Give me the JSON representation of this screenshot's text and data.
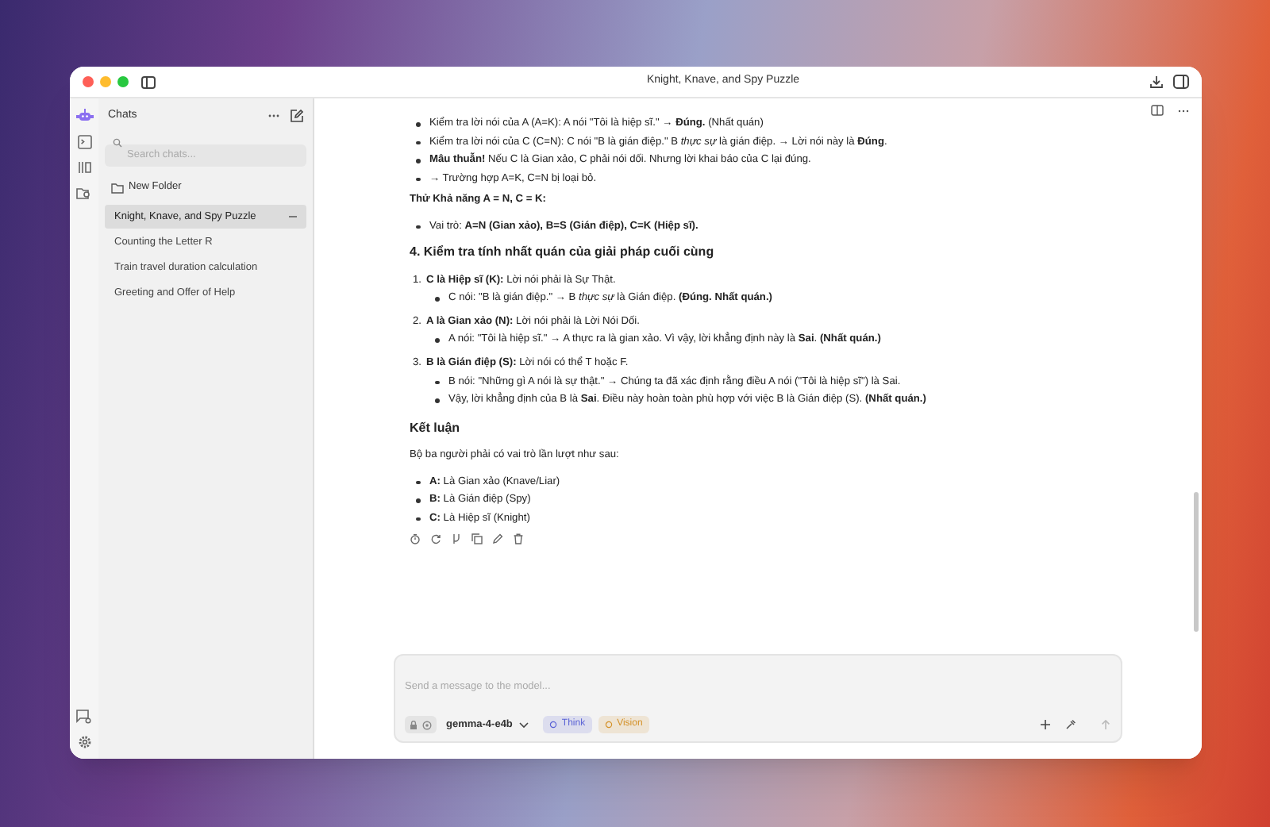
{
  "window": {
    "title": "Knight, Knave, and Spy Puzzle"
  },
  "sidebar": {
    "title": "Chats",
    "search": {
      "placeholder": "Search chats..."
    },
    "new_folder": "New Folder",
    "chats": [
      {
        "title": "Knight, Knave, and Spy Puzzle",
        "selected": true
      },
      {
        "title": "Counting the Letter R",
        "selected": false
      },
      {
        "title": "Train travel duration calculation",
        "selected": false
      },
      {
        "title": "Greeting and Offer of Help",
        "selected": false
      }
    ]
  },
  "content": [
    {
      "kind": "bullets",
      "items": [
        {
          "text": "Kiểm tra lời nói của A (A=K): A nói \"Tôi là hiệp sĩ.\" → **Đúng.** (Nhất quán)"
        },
        {
          "text": "Kiểm tra lời nói của C (C=N): C nói \"B là gián điệp.\" B *thực sự* là gián điệp. → Lời nói này là **Đúng**."
        },
        {
          "text": "**Mâu thuẫn!** Nếu C là Gian xảo, C phải nói dối. Nhưng lời khai báo của C lại đúng."
        },
        {
          "text": "→ Trường hợp A=K, C=N bị loại bỏ."
        }
      ]
    },
    {
      "kind": "subheading",
      "text": "Thử Khả năng A = N, C = K:"
    },
    {
      "kind": "bullets",
      "items": [
        {
          "text": "Vai trò: **A=N (Gian xảo), B=S (Gián điệp), C=K (Hiệp sĩ).**"
        }
      ]
    },
    {
      "kind": "heading",
      "text": "4. Kiểm tra tính nhất quán của giải pháp cuối cùng"
    },
    {
      "kind": "numbered",
      "items": [
        {
          "number": "1.",
          "text": "**C là Hiệp sĩ (K):** Lời nói phải là Sự Thật.",
          "children": [
            {
              "text": "C nói: \"B là gián điệp.\" → B *thực sự* là Gián điệp. **(Đúng. Nhất quán.)**"
            }
          ]
        },
        {
          "number": "2.",
          "text": "**A là Gian xảo (N):** Lời nói phải là Lời Nói Dối.",
          "children": [
            {
              "text": "A nói: \"Tôi là hiệp sĩ.\" → A thực ra là gian xảo. Vì vậy, lời khẳng định này là **Sai**. **(Nhất quán.)**"
            }
          ]
        },
        {
          "number": "3.",
          "text": "**B là Gián điệp (S):** Lời nói có thể T hoặc F.",
          "children": [
            {
              "text": "B nói: \"Những gì A nói là sự thật.\" → Chúng ta đã xác định rằng điều A nói (\"Tôi là hiệp sĩ\") là Sai."
            },
            {
              "text": "Vậy, lời khẳng định của B là **Sai**. Điều này hoàn toàn phù hợp với việc B là Gián điệp (S). **(Nhất quán.)**"
            }
          ]
        }
      ]
    },
    {
      "kind": "heading",
      "text": "Kết luận"
    },
    {
      "kind": "paragraph",
      "text": "Bộ ba người phải có vai trò lần lượt như sau:"
    },
    {
      "kind": "bullets",
      "items": [
        {
          "text": "**A:** Là Gian xảo (Knave/Liar)"
        },
        {
          "text": "**B:** Là Gián điệp (Spy)"
        },
        {
          "text": "**C:** Là Hiệp sĩ (Knight)"
        }
      ]
    }
  ],
  "composer": {
    "placeholder": "Send a message to the model...",
    "model": "gemma-4-e4b",
    "capabilities": [
      {
        "label": "Think",
        "color": "#5b63d6"
      },
      {
        "label": "Vision",
        "color": "#d4922a"
      }
    ]
  }
}
